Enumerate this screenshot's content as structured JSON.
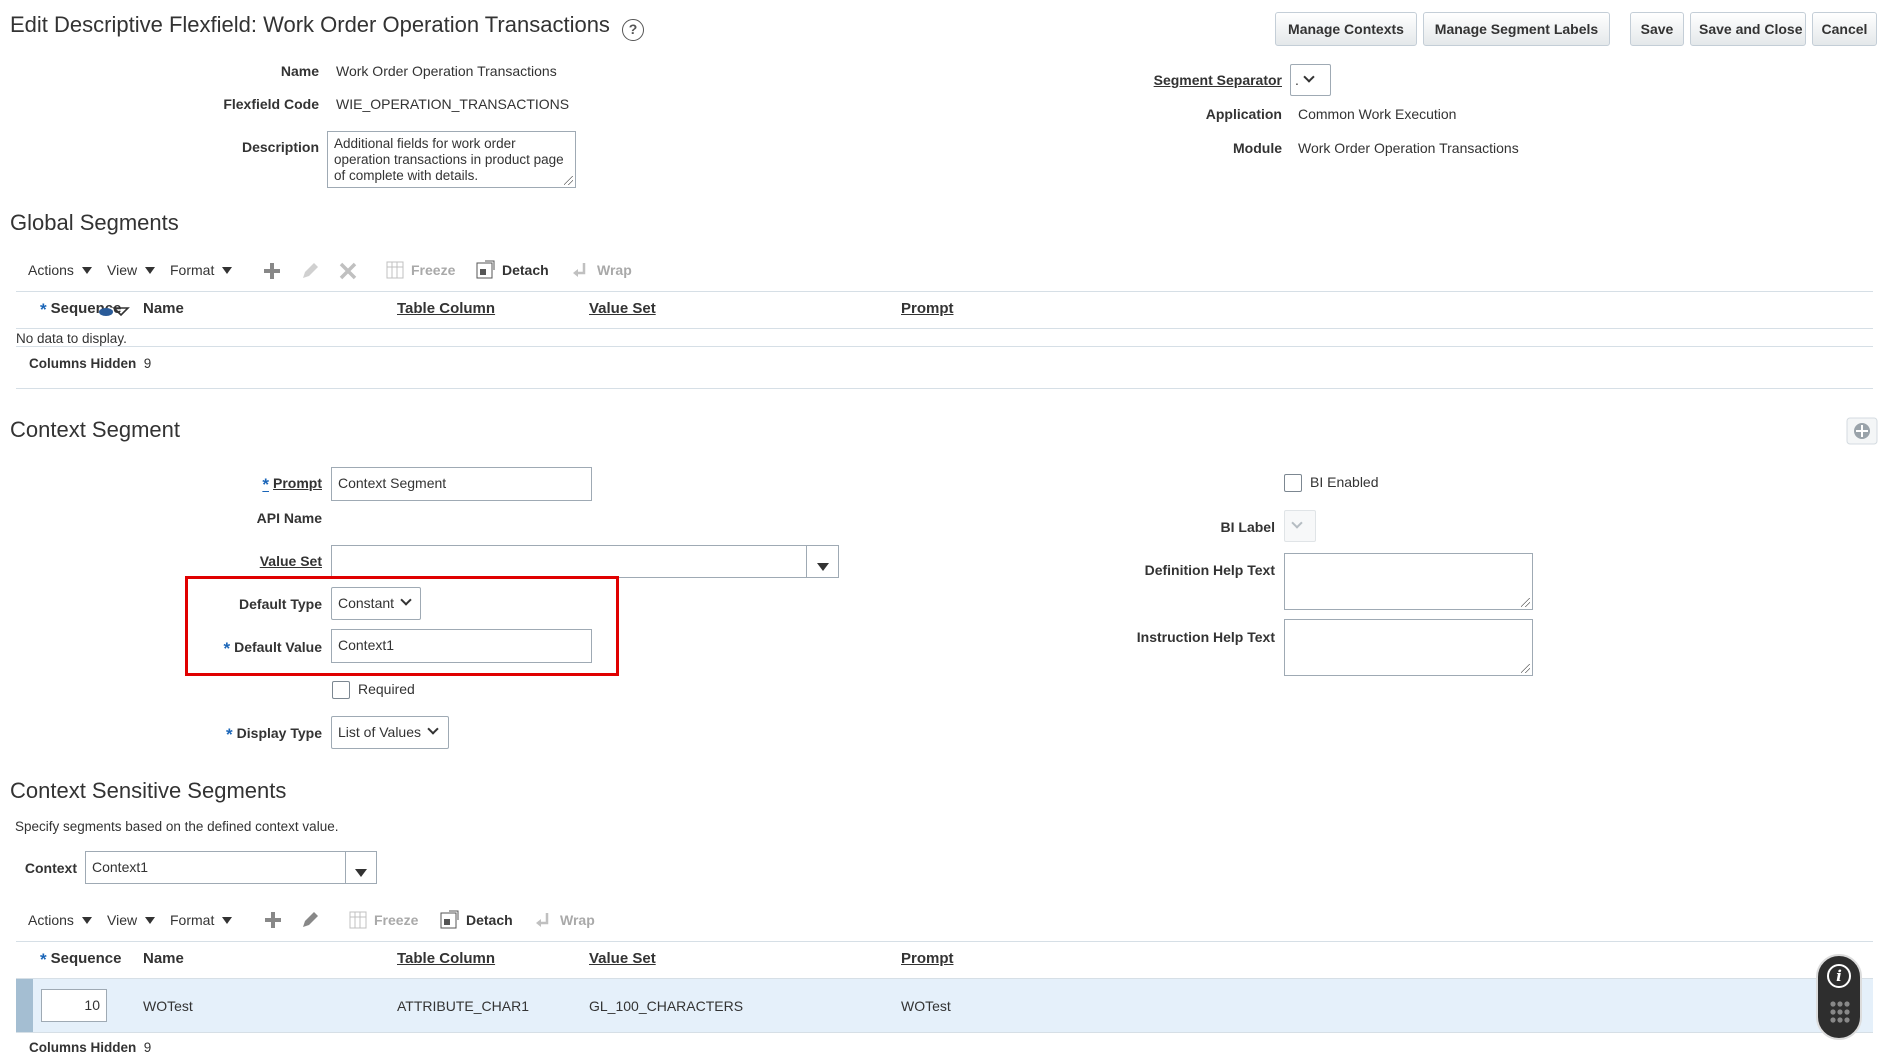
{
  "header": {
    "title": "Edit Descriptive Flexfield: Work Order Operation Transactions",
    "help_glyph": "?",
    "buttons": {
      "manage_contexts": "Manage Contexts",
      "manage_segment_labels": "Manage Segment Labels",
      "save": "Save",
      "save_and_close": "Save and Close",
      "cancel": "Cancel"
    }
  },
  "flexfield": {
    "name_label": "Name",
    "name_value": "Work Order Operation Transactions",
    "code_label": "Flexfield Code",
    "code_value": "WIE_OPERATION_TRANSACTIONS",
    "description_label": "Description",
    "description_value": "Additional fields for work order operation transactions in product page of complete with details.",
    "separator_label": "Segment Separator",
    "separator_value": ".",
    "application_label": "Application",
    "application_value": "Common Work Execution",
    "module_label": "Module",
    "module_value": "Work Order Operation Transactions"
  },
  "global_segments": {
    "title": "Global Segments",
    "toolbar": {
      "actions": "Actions",
      "view": "View",
      "format": "Format",
      "freeze": "Freeze",
      "detach": "Detach",
      "wrap": "Wrap"
    },
    "columns": {
      "sequence": "Sequence",
      "name": "Name",
      "table_column": "Table Column",
      "value_set": "Value Set",
      "prompt": "Prompt"
    },
    "empty_text": "No data to display.",
    "columns_hidden_label": "Columns Hidden",
    "columns_hidden_value": "9"
  },
  "context_segment": {
    "title": "Context Segment",
    "prompt_label": "Prompt",
    "prompt_value": "Context Segment",
    "api_name_label": "API Name",
    "value_set_label": "Value Set",
    "value_set_value": "",
    "default_type_label": "Default Type",
    "default_type_value": "Constant",
    "default_value_label": "Default Value",
    "default_value_value": "Context1",
    "required_label": "Required",
    "required_checked": false,
    "display_type_label": "Display Type",
    "display_type_value": "List of Values",
    "bi_enabled_label": "BI Enabled",
    "bi_enabled_checked": false,
    "bi_label_label": "BI Label",
    "definition_help_label": "Definition Help Text",
    "definition_help_value": "",
    "instruction_help_label": "Instruction Help Text",
    "instruction_help_value": "",
    "highlight_color": "#e00000"
  },
  "context_sensitive": {
    "title": "Context Sensitive Segments",
    "description": "Specify segments based on the defined context value.",
    "context_label": "Context",
    "context_value": "Context1",
    "toolbar": {
      "actions": "Actions",
      "view": "View",
      "format": "Format",
      "freeze": "Freeze",
      "detach": "Detach",
      "wrap": "Wrap"
    },
    "columns": {
      "sequence": "Sequence",
      "name": "Name",
      "table_column": "Table Column",
      "value_set": "Value Set",
      "prompt": "Prompt"
    },
    "rows": [
      {
        "sequence": "10",
        "name": "WOTest",
        "table_column": "ATTRIBUTE_CHAR1",
        "value_set": "GL_100_CHARACTERS",
        "prompt": "WOTest"
      }
    ],
    "columns_hidden_label": "Columns Hidden",
    "columns_hidden_value": "9",
    "selected_row_color": "#e5f0fa"
  },
  "required_marker": "*",
  "info_glyph": "i"
}
